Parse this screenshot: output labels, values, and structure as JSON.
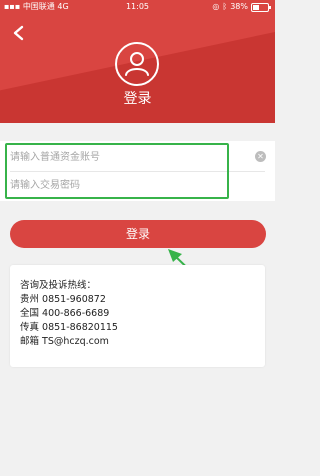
{
  "status": {
    "carrier": "中国联通",
    "network": "4G",
    "time": "11:05",
    "battery": "38%"
  },
  "header": {
    "title": "登录"
  },
  "form": {
    "account_placeholder": "请输入普通资金账号",
    "password_placeholder": "请输入交易密码"
  },
  "login_button": "登录",
  "contact": {
    "heading": "咨询及投诉热线：",
    "lines": [
      "贵州 0851-960872",
      "全国 400-866-6689",
      "传真 0851-86820115",
      "邮箱 TS@hczq.com"
    ]
  },
  "colors": {
    "brand_red": "#d94541",
    "highlight_green": "#37b34a"
  }
}
